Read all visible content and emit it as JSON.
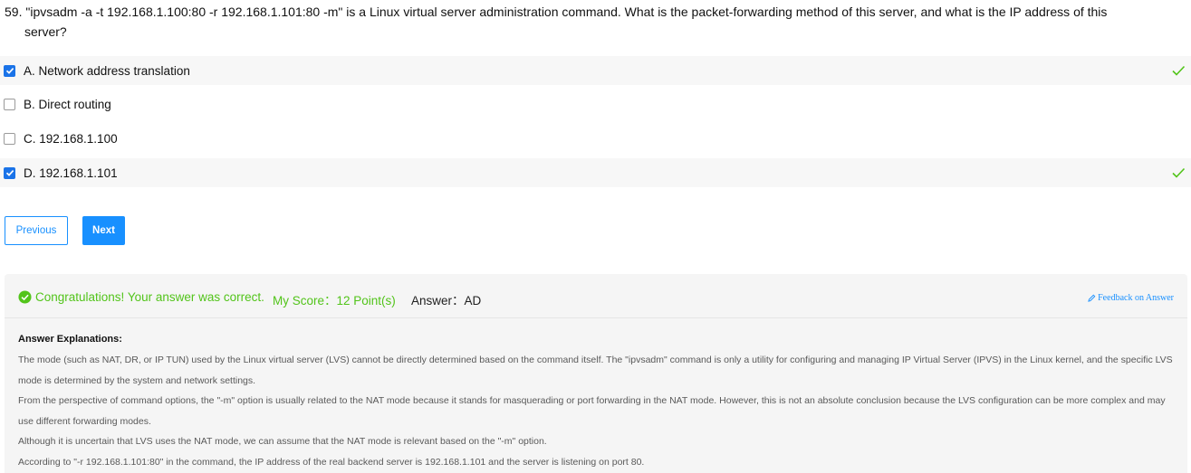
{
  "question": {
    "number": "59.",
    "text_line1": "\"ipvsadm -a -t 192.168.1.100:80 -r 192.168.1.101:80 -m\" is a Linux virtual server administration command. What is the packet-forwarding method of this server, and what is the IP address of this",
    "text_line2": "server?"
  },
  "options": [
    {
      "label": "A. Network address translation",
      "checked": true,
      "correct": true
    },
    {
      "label": "B. Direct routing",
      "checked": false,
      "correct": false
    },
    {
      "label": "C. 192.168.1.100",
      "checked": false,
      "correct": false
    },
    {
      "label": "D. 192.168.1.101",
      "checked": true,
      "correct": true
    }
  ],
  "buttons": {
    "previous": "Previous",
    "next": "Next"
  },
  "result": {
    "congrats": "Congratulations! Your answer was correct.",
    "score_label": "My Score：12 Point(s)",
    "answer_label": "Answer：AD",
    "feedback_link": "Feedback on Answer"
  },
  "explanation": {
    "title": "Answer Explanations:",
    "paragraphs": [
      "The mode (such as NAT, DR, or IP TUN) used by the Linux virtual server (LVS) cannot be directly determined based on the command itself. The \"ipvsadm\" command is only a utility for configuring and managing IP Virtual Server (IPVS) in the Linux kernel, and the specific LVS mode is determined by the system and network settings.",
      "From the perspective of command options, the \"-m\" option is usually related to the NAT mode because it stands for masquerading or port forwarding in the NAT mode. However, this is not an absolute conclusion because the LVS configuration can be more complex and may use different forwarding modes.",
      "Although it is uncertain that LVS uses the NAT mode, we can assume that the NAT mode is relevant based on the \"-m\" option.",
      "According to \"-r 192.168.1.101:80\" in the command, the IP address of the real backend server is 192.168.1.101 and the server is listening on port 80."
    ]
  },
  "colors": {
    "accent": "#1890ff",
    "checkbox": "#1a73e8",
    "success": "#52c41a"
  },
  "icons": {
    "checkbox_check": "check-icon",
    "correct_mark": "tick-icon",
    "success_circle": "check-circle-icon",
    "feedback": "edit-icon"
  }
}
